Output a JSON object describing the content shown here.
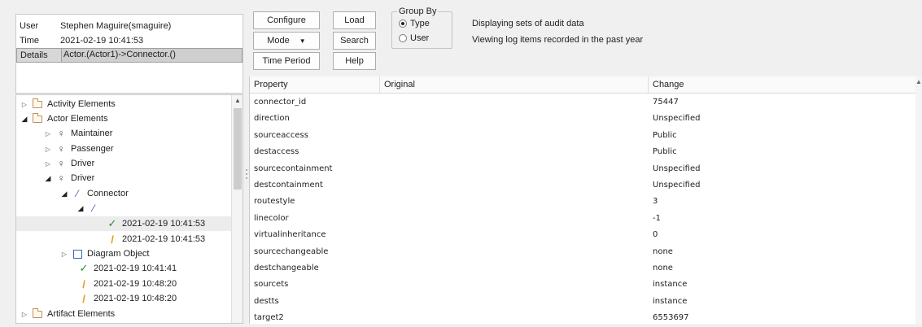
{
  "info": {
    "rows": [
      {
        "key": "User",
        "value": "Stephen Maguire(smaguire)"
      },
      {
        "key": "Time",
        "value": "2021-02-19 10:41:53"
      },
      {
        "key": "Details",
        "value": "Actor.(Actor1)->Connector.()"
      }
    ]
  },
  "toolbar": {
    "configure": "Configure",
    "load": "Load",
    "mode": "Mode",
    "search": "Search",
    "time_period": "Time Period",
    "help": "Help"
  },
  "group_by": {
    "title": "Group By",
    "options": [
      {
        "label": "Type",
        "selected": true
      },
      {
        "label": "User",
        "selected": false
      }
    ]
  },
  "status": {
    "line1": "Displaying sets of audit data",
    "line2": "Viewing log items recorded in the past year"
  },
  "tree": {
    "items": [
      {
        "label": "Activity Elements",
        "icon": "folder-icon",
        "state": "collapsed"
      },
      {
        "label": "Actor Elements",
        "icon": "folder-icon",
        "state": "expanded"
      },
      {
        "label": "Maintainer",
        "icon": "actor-icon",
        "state": "collapsed"
      },
      {
        "label": "Passenger",
        "icon": "actor-icon",
        "state": "collapsed"
      },
      {
        "label": "Driver",
        "icon": "actor-icon",
        "state": "collapsed"
      },
      {
        "label": "Driver",
        "icon": "actor-icon",
        "state": "expanded"
      },
      {
        "label": "Connector",
        "icon": "connector-icon",
        "state": "expanded"
      },
      {
        "label": "",
        "icon": "connector-icon",
        "state": "expanded"
      },
      {
        "label": "2021-02-19 10:41:53",
        "icon": "check-icon",
        "state": "leaf",
        "selected": true
      },
      {
        "label": "2021-02-19 10:41:53",
        "icon": "pencil-icon",
        "state": "leaf"
      },
      {
        "label": "Diagram Object",
        "icon": "diagram-object-icon",
        "state": "collapsed"
      },
      {
        "label": "2021-02-19 10:41:41",
        "icon": "check-icon",
        "state": "leaf"
      },
      {
        "label": "2021-02-19 10:48:20",
        "icon": "pencil-icon",
        "state": "leaf"
      },
      {
        "label": "2021-02-19 10:48:20",
        "icon": "pencil-icon",
        "state": "leaf"
      },
      {
        "label": "Artifact Elements",
        "icon": "folder-icon",
        "state": "collapsed"
      }
    ]
  },
  "grid": {
    "columns": [
      "Property",
      "Original",
      "Change"
    ],
    "rows": [
      {
        "property": "connector_id",
        "original": "",
        "change": "75447"
      },
      {
        "property": "direction",
        "original": "",
        "change": "Unspecified"
      },
      {
        "property": "sourceaccess",
        "original": "",
        "change": "Public"
      },
      {
        "property": "destaccess",
        "original": "",
        "change": "Public"
      },
      {
        "property": "sourcecontainment",
        "original": "",
        "change": "Unspecified"
      },
      {
        "property": "destcontainment",
        "original": "",
        "change": "Unspecified"
      },
      {
        "property": "routestyle",
        "original": "",
        "change": "3"
      },
      {
        "property": "linecolor",
        "original": "",
        "change": "-1"
      },
      {
        "property": "virtualinheritance",
        "original": "",
        "change": "0"
      },
      {
        "property": "sourcechangeable",
        "original": "",
        "change": "none"
      },
      {
        "property": "destchangeable",
        "original": "",
        "change": "none"
      },
      {
        "property": "sourcets",
        "original": "",
        "change": "instance"
      },
      {
        "property": "destts",
        "original": "",
        "change": "instance"
      },
      {
        "property": "target2",
        "original": "",
        "change": "6553697"
      }
    ]
  }
}
